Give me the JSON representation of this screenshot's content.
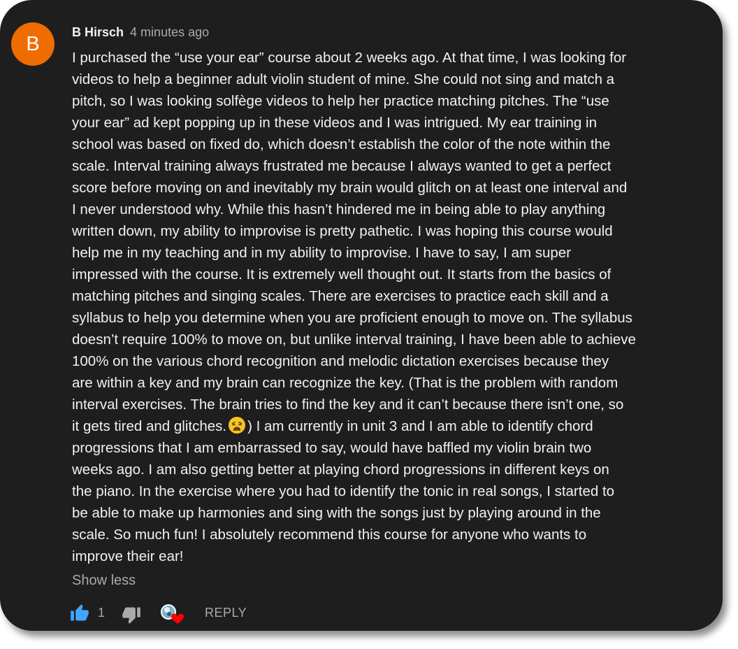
{
  "comment": {
    "avatar_letter": "B",
    "author": "B Hirsch",
    "timestamp": "4 minutes ago",
    "lines": [
      "I purchased the “use your ear” course about 2 weeks ago. At that time, I was looking for",
      "videos to help a beginner adult violin student of mine. She could not sing and match a",
      "pitch, so I was looking solfège videos to help her practice matching pitches. The “use",
      "your ear” ad kept popping up in these videos and I was intrigued.  My ear training in",
      "school was based on fixed do, which doesn’t establish the color of the note within the",
      "scale. Interval training always frustrated me because I always wanted to get a perfect",
      "score before moving on and inevitably my brain would glitch on at least one interval and",
      "I never understood why. While this hasn’t hindered me in being able to play anything",
      "written down, my ability to improvise is pretty pathetic. I was hoping this course would",
      "help me in my teaching and in my ability to improvise. I have to say, I am super",
      "impressed with the course. It is extremely well thought out. It starts from the basics of",
      "matching pitches and singing scales. There are exercises to practice each skill and a",
      "syllabus to help you determine when you are proficient enough to move on. The syllabus",
      "doesn’t require 100% to move on, but unlike interval training, I have been able to achieve",
      "100% on the various chord recognition and melodic dictation exercises because they",
      "are within a key and my brain can recognize the key. (That is the problem with random",
      "interval exercises. The brain tries to find the key and it can’t because there isn’t one, so"
    ],
    "emoji_line_before": "it gets tired and glitches.",
    "emoji_icon": "weary-face-icon",
    "emoji_line_after": ") I am currently in unit 3 and I am able to identify chord",
    "lines_after": [
      "progressions that I am embarrassed to say, would have baffled my violin brain two",
      "weeks ago. I am also getting better at playing chord progressions in different keys on",
      "the piano. In the exercise where you had to identify the tonic in real songs, I started to",
      "be able to make up harmonies and sing with the songs just by playing around in the",
      "scale. So much fun! I absolutely recommend this course for anyone who wants to",
      "improve their ear!"
    ],
    "show_less_label": "Show less"
  },
  "actions": {
    "like_icon": "thumbs-up-icon",
    "like_count": "1",
    "dislike_icon": "thumbs-down-icon",
    "creator_heart_icon": "creator-heart-icon",
    "reply_label": "REPLY"
  },
  "colors": {
    "background": "#1e1e1e",
    "avatar": "#ef6c00",
    "text": "#f1f1f1",
    "secondary_text": "#aaaaaa",
    "like_active": "#3ea6ff",
    "heart": "#ff0000"
  }
}
